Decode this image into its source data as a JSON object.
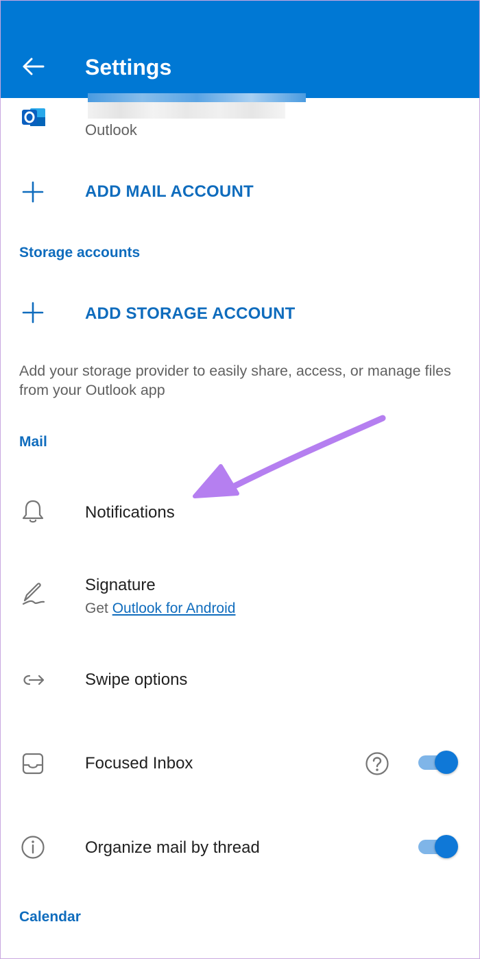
{
  "appbar": {
    "title": "Settings",
    "back_icon": "arrow-left-icon"
  },
  "account": {
    "type": "Outlook",
    "icon": "outlook-logo-icon"
  },
  "add_mail_account": {
    "label": "ADD MAIL ACCOUNT",
    "icon": "plus-icon"
  },
  "storage": {
    "header": "Storage accounts",
    "add_label": "ADD STORAGE ACCOUNT",
    "helper": "Add your storage provider to easily share, access, or manage files from your Outlook app"
  },
  "mail": {
    "header": "Mail",
    "notifications": {
      "label": "Notifications",
      "icon": "bell-icon"
    },
    "signature": {
      "label": "Signature",
      "sub_prefix": "Get ",
      "sub_link": "Outlook for Android",
      "icon": "pen-signature-icon"
    },
    "swipe": {
      "label": "Swipe options",
      "icon": "swipe-arrow-icon"
    },
    "focused_inbox": {
      "label": "Focused Inbox",
      "icon": "inbox-tray-icon",
      "help_icon": "question-circle-icon",
      "enabled": true
    },
    "organize_thread": {
      "label": "Organize mail by thread",
      "icon": "info-circle-icon",
      "enabled": true
    }
  },
  "calendar": {
    "header": "Calendar"
  },
  "colors": {
    "appbar": "#0078d4",
    "accent": "#0f6cbd",
    "annotation_arrow": "#b57ff0"
  }
}
